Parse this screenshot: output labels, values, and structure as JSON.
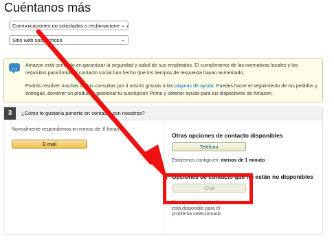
{
  "page": {
    "title": "Cuéntanos más"
  },
  "form": {
    "issue_select": "Comunicaciones no solicitadas o reclamaciones fra",
    "subissue_select": "Sitio web sospechoso"
  },
  "notice": {
    "paragraph1": "Amazon está centrado en garantizar la seguridad y salud de sus empleados. El cumplimiento de las normativas locales y los requisitos para limitar el contacto social han hecho que los tiempos de respuesta hayan aumentado.",
    "paragraph2_before": "Podrás resolver muchas de tus consultas por ti mismo gracias a las ",
    "paragraph2_link": "páginas de ayuda",
    "paragraph2_after": ". Puedes hacer el seguimiento de tus pedidos y entregas, devolver un producto, gestionar tu suscripción Prime y obtener ayuda para tus dispositivos de Amazon."
  },
  "contact": {
    "step_number": "3",
    "question": "¿Cómo te gustaría ponerte en contacto con nosotros?",
    "email_note": "Normalmente respondemos en menos de: 6 horas",
    "email_button": "E-mail",
    "other_options_title": "Otras opciones de contacto disponibles",
    "phone_button": "Teléfono",
    "phone_wait_label": "Estaremos contigo en: ",
    "phone_wait_value": "menos de 1 minuto",
    "unavailable_title": "Opciones de contacto que no están no disponibles",
    "chat_button": "Chat",
    "chat_note": "Nuestro servicio de chat no está disponible para el problema seleccionado"
  },
  "colors": {
    "annotation": "#ee1111",
    "primary_button": "#f0c14b",
    "link": "#0066c0"
  }
}
